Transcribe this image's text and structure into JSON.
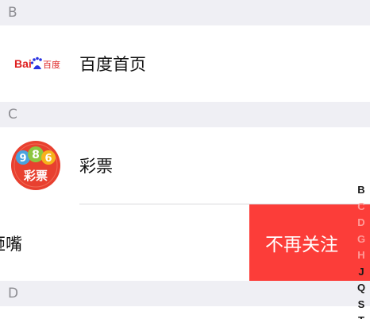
{
  "sections": [
    {
      "header": "B",
      "items": [
        {
          "title": "百度首页",
          "icon": "baidu-logo"
        }
      ]
    },
    {
      "header": "C",
      "items": [
        {
          "title": "彩票",
          "icon": "lottery-icon"
        },
        {
          "title": "砸嘴",
          "icon": ""
        }
      ]
    },
    {
      "header": "D",
      "items": []
    }
  ],
  "baidu_logo_text": {
    "part1": "Bai",
    "part2": "百度"
  },
  "lottery_icon_text": {
    "numbers": [
      "9",
      "8",
      "6"
    ],
    "label": "彩票"
  },
  "swipe_action": {
    "label": "不再关注",
    "color": "#fc3d39"
  },
  "index_bar": [
    "B",
    "C",
    "D",
    "G",
    "H",
    "J",
    "Q",
    "S",
    "T"
  ],
  "colors": {
    "section_bg": "#efeff4",
    "section_text": "#8e8e93",
    "baidu_red": "#de1f1f",
    "baidu_blue": "#2932e1"
  }
}
